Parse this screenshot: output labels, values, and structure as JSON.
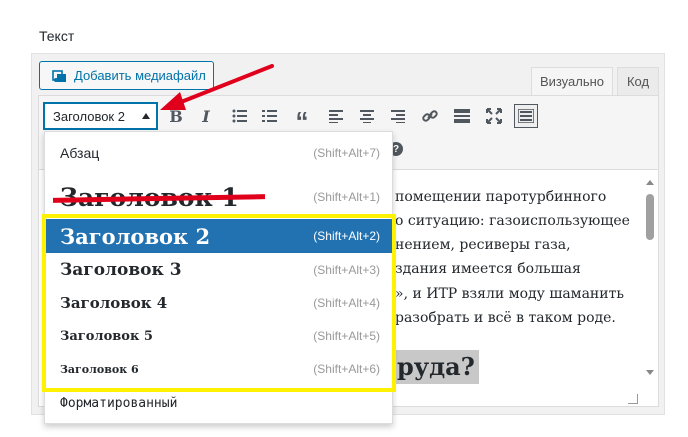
{
  "field_label": "Текст",
  "media_button": "Добавить медиафайл",
  "tabs": {
    "visual": "Визуально",
    "code": "Код"
  },
  "toolbar": {
    "format_value": "Заголовок 2",
    "bold": "B",
    "italic": "I",
    "quote": "“",
    "help": "?"
  },
  "dropdown": {
    "items": [
      {
        "label": "Абзац",
        "shortcut": "(Shift+Alt+7)"
      },
      {
        "label": "Заголовок 1",
        "shortcut": "(Shift+Alt+1)"
      },
      {
        "label": "Заголовок 2",
        "shortcut": "(Shift+Alt+2)"
      },
      {
        "label": "Заголовок 3",
        "shortcut": "(Shift+Alt+3)"
      },
      {
        "label": "Заголовок 4",
        "shortcut": "(Shift+Alt+4)"
      },
      {
        "label": "Заголовок 5",
        "shortcut": "(Shift+Alt+5)"
      },
      {
        "label": "Заголовок 6",
        "shortcut": "(Shift+Alt+6)"
      },
      {
        "label": "Форматированный"
      }
    ],
    "selected": "Заголовок 2"
  },
  "content": {
    "lines": [
      "помещении паротурбинного",
      "о ситуацию: газоиспользующее",
      "нением, ресиверы газа,",
      "здания имеется большая",
      "», и ИТР взяли моду шаманить",
      "разобрать и всё в таком роде."
    ],
    "heading_fragment": "руда?"
  },
  "colors": {
    "accent": "#0073aa",
    "selected_bg": "#2271b1",
    "highlight_box": "#fff200",
    "annotation_red": "#e0001b"
  }
}
